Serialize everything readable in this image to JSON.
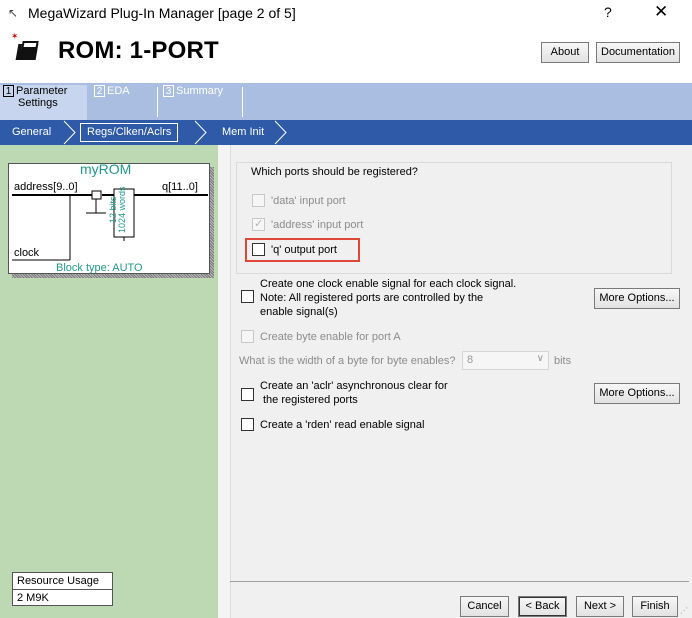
{
  "window": {
    "title": "MegaWizard Plug-In Manager [page 2 of 5]",
    "help": "?",
    "close": "✕"
  },
  "header": {
    "title": "ROM: 1-PORT",
    "about_label": "About",
    "documentation_label": "Documentation"
  },
  "tabs": [
    {
      "number": "1",
      "label_line1": "Parameter",
      "label_line2": "Settings",
      "active": true
    },
    {
      "number": "2",
      "label_line1": "EDA",
      "label_line2": "",
      "active": false
    },
    {
      "number": "3",
      "label_line1": "Summary",
      "label_line2": "",
      "active": false
    }
  ],
  "breadcrumbs": [
    "General",
    "Regs/Clken/Aclrs",
    "Mem Init"
  ],
  "diagram": {
    "name": "myROM",
    "input_address": "address[9..0]",
    "output_q": "q[11..0]",
    "input_clock": "clock",
    "mem_bits": "12 bits",
    "mem_words": "1024 words",
    "block_type": "Block type: AUTO"
  },
  "resource": {
    "header": "Resource Usage",
    "value": "2 M9K"
  },
  "registered_ports": {
    "title": "Which ports should be registered?",
    "data_port": {
      "label": "'data' input port",
      "checked": false,
      "enabled": false
    },
    "address_port": {
      "label": "'address' input port",
      "checked": true,
      "enabled": false
    },
    "q_port": {
      "label": "'q' output port",
      "checked": false,
      "enabled": true
    }
  },
  "options": {
    "clock_enable_line1": "Create one clock enable signal for each clock signal.",
    "clock_enable_line2": "Note: All registered ports are controlled by the",
    "clock_enable_line3": "enable signal(s)",
    "more_options_label": "More Options...",
    "byte_enable_label": "Create byte enable for port A",
    "byte_width_label": "What is the width of a byte for byte enables?",
    "byte_width_value": "8",
    "byte_width_unit": "bits",
    "aclr_line1": "Create an 'aclr' asynchronous clear for",
    "aclr_line2": "the registered ports",
    "rden_label": "Create a 'rden' read enable signal"
  },
  "footer": {
    "cancel_label": "Cancel",
    "back_label": "< Back",
    "next_label": "Next >",
    "finish_label": "Finish"
  },
  "colors": {
    "tab_band": "#aabee1",
    "breadcrumb_band": "#2e5aa8",
    "left_pane": "#bcd9b4",
    "diagram_teal": "#1f9a8a",
    "highlight": "#e0473b"
  }
}
